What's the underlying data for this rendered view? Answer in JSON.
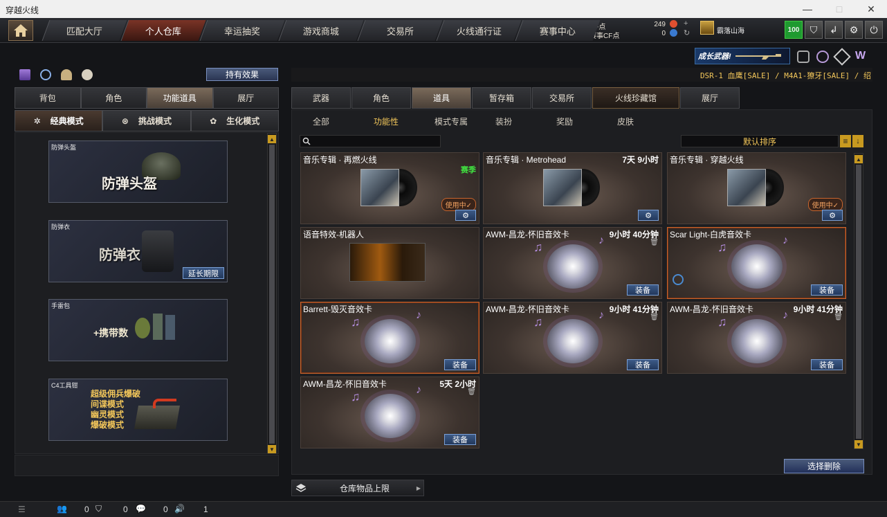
{
  "window": {
    "title": "穿越火线",
    "minimize": "—",
    "maximize": "□",
    "close": "✕"
  },
  "nav": {
    "tabs": [
      "匹配大厅",
      "个人仓库",
      "幸运抽奖",
      "游戏商城",
      "交易所",
      "火线通行证",
      "赛事中心"
    ],
    "active": 1
  },
  "account": {
    "cf_label": "CF点",
    "cf_value": "249",
    "match_cf_label": "赛事CF点",
    "match_cf_value": "0",
    "username": "霸落山海",
    "level": "100"
  },
  "colors": {
    "accent": "#f2c65a",
    "equip_button": "#2e4a76",
    "highlight_border": "#c8662e",
    "active_nav": "#7a3326"
  },
  "banner": {
    "text": "成长武器!"
  },
  "ticker": "DSR-1 血鹰[SALE] / M4A1-獠牙[SALE] / 绍",
  "left": {
    "effect_button": "持有效果",
    "tabs": [
      "背包",
      "角色",
      "功能道具",
      "展厅"
    ],
    "active_tab": 2,
    "modes": [
      "经典模式",
      "挑战模式",
      "生化模式"
    ],
    "active_mode": 0,
    "slots": [
      {
        "name": "防弹头盔",
        "art_text": "防弹头盔"
      },
      {
        "name": "防弹衣",
        "art_text": "防弹衣",
        "action": "延长期限"
      },
      {
        "name": "手雷包",
        "art_text": "+携带数"
      },
      {
        "name": "C4工具钳",
        "modes": [
          "超级佣兵爆破",
          "间谍模式",
          "幽灵模式",
          "爆破模式"
        ]
      }
    ]
  },
  "right": {
    "tabs": [
      "武器",
      "角色",
      "道具",
      "暂存箱",
      "交易所",
      "火线珍藏馆",
      "展厅"
    ],
    "active_tab": 2,
    "special_tab": 5,
    "subtabs": [
      "全部",
      "功能性",
      "模式专属",
      "装扮",
      "奖励",
      "皮肤"
    ],
    "active_subtab": 1,
    "search_placeholder": "",
    "sort_label": "默认排序",
    "items": [
      {
        "name": "音乐专辑 · 再燃火线",
        "tag": "赛季",
        "status": "使用中✓",
        "kind": "album",
        "button": "⚙"
      },
      {
        "name": "音乐专辑 · Metrohead",
        "time": "7天 9小时",
        "kind": "album",
        "button": "⚙"
      },
      {
        "name": "音乐专辑 · 穿越火线",
        "status": "使用中✓",
        "kind": "album",
        "button": "⚙"
      },
      {
        "name": "语音特效-机器人",
        "kind": "voice"
      },
      {
        "name": "AWM-昌龙-怀旧音效卡",
        "time": "9小时 40分钟",
        "kind": "disc",
        "button": "装备"
      },
      {
        "name": "Scar Light-白虎音效卡",
        "kind": "disc",
        "button": "装备",
        "highlight": true
      },
      {
        "name": "Barrett-毁灭音效卡",
        "kind": "disc",
        "button": "装备",
        "highlight": true
      },
      {
        "name": "AWM-昌龙-怀旧音效卡",
        "time": "9小时 41分钟",
        "kind": "disc",
        "button": "装备"
      },
      {
        "name": "AWM-昌龙-怀旧音效卡",
        "time": "9小时 41分钟",
        "kind": "disc",
        "button": "装备"
      },
      {
        "name": "AWM-昌龙-怀旧音效卡",
        "time": "5天 2小时",
        "kind": "disc",
        "button": "装备"
      }
    ],
    "delete_button": "选择删除",
    "capacity_label": "仓库物品上限"
  },
  "status": {
    "counts": [
      "0",
      "0",
      "0",
      "1"
    ]
  }
}
